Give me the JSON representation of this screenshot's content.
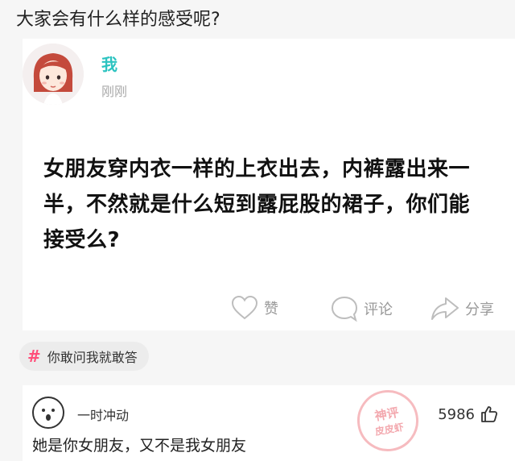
{
  "headline": "大家会有什么样的感受呢?",
  "post": {
    "user_name": "我",
    "time": "刚刚",
    "text": "女朋友穿内衣一样的上衣出去，内裤露出来一半，不然就是什么短到露屁股的裙子，你们能接受么?",
    "actions": {
      "like": "赞",
      "comment": "评论",
      "share": "分享"
    }
  },
  "topic": {
    "icon": "hash-icon",
    "label": "你敢问我就敢答"
  },
  "comment": {
    "user_name": "一时冲动",
    "likes": "5986",
    "text": "她是你女朋友，又不是我女朋友"
  },
  "watermark": {
    "line1": "神评",
    "line2": "皮皮虾"
  },
  "colors": {
    "accent": "#2cc3c0",
    "topic_hash": "#ff4d79"
  }
}
